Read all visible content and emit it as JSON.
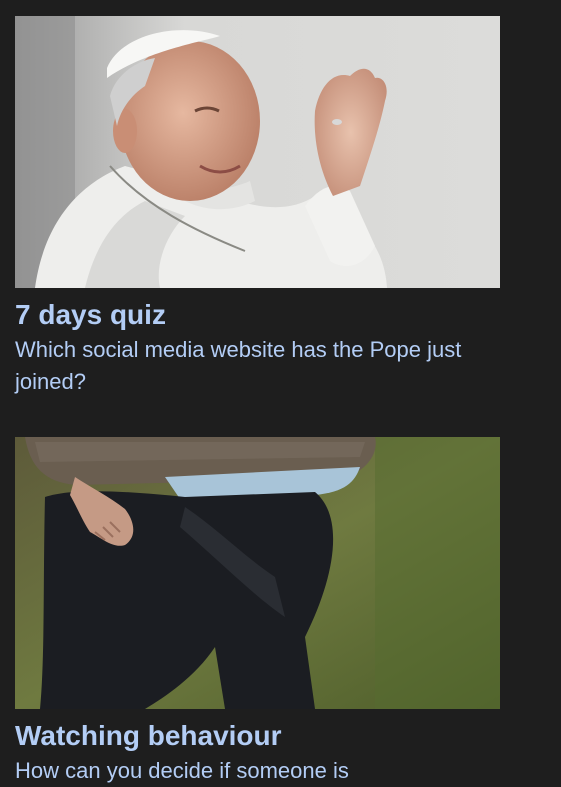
{
  "stories": [
    {
      "title": "7 days quiz",
      "summary": "Which social media website has the Pope just joined?",
      "image_alt": "Pope Francis waving"
    },
    {
      "title": "Watching behaviour",
      "summary": "How can you decide if someone is",
      "image_alt": "Man walking on grass with hand behind back"
    }
  ],
  "colors": {
    "background": "#1e1e1e",
    "link": "#b3cdf5"
  }
}
